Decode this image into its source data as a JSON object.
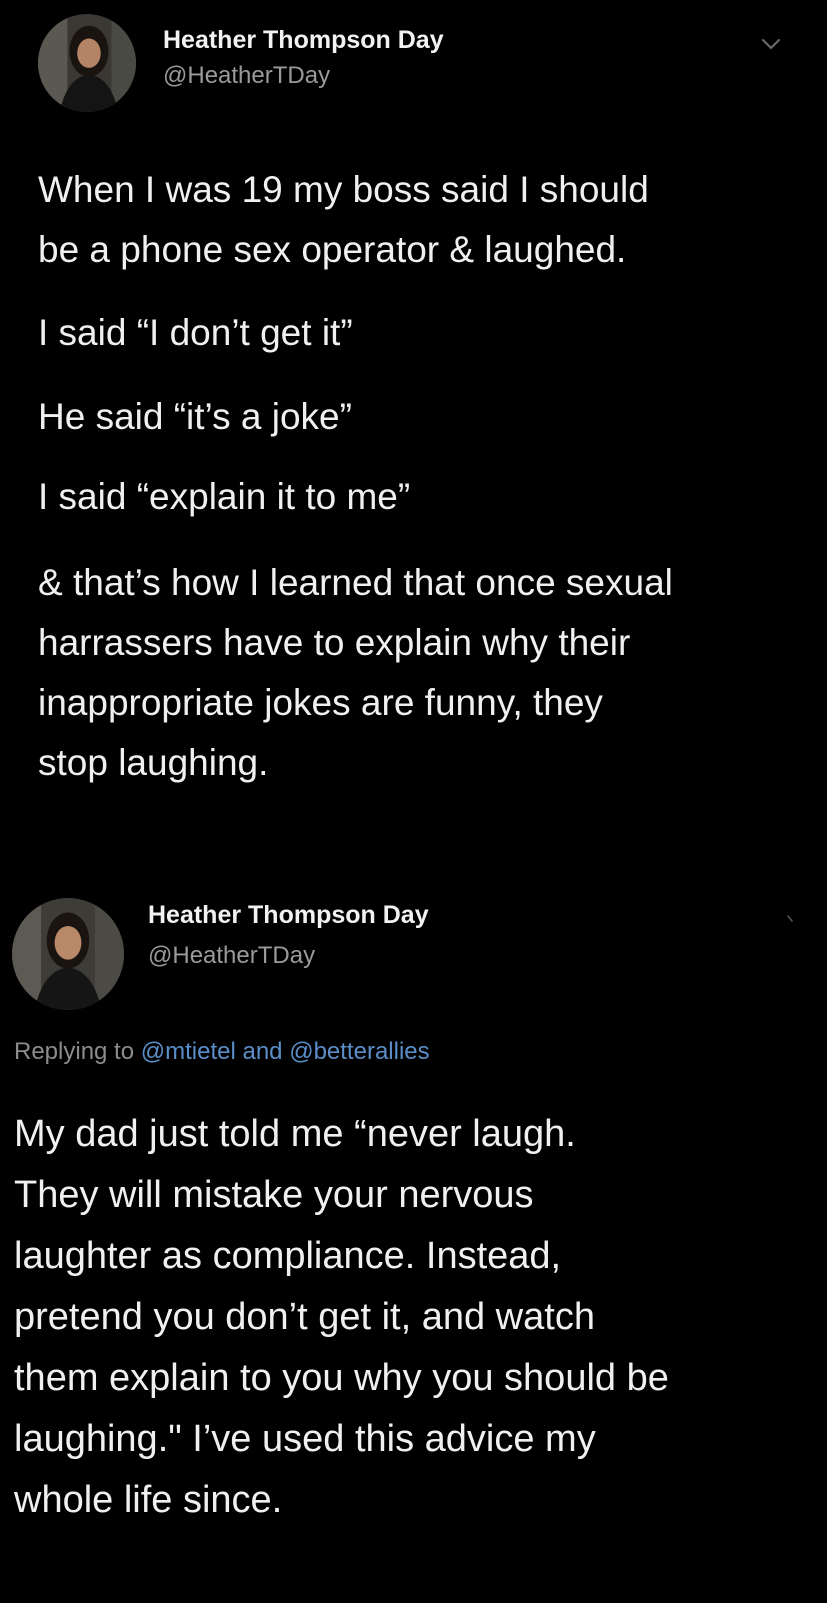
{
  "tweets": [
    {
      "author": {
        "name": "Heather Thompson Day",
        "handle": "@HeatherTDay",
        "avatar_icon": "profile-photo"
      },
      "menu_icon": "chevron-down-icon",
      "paragraphs": [
        "When I was 19 my boss said I should\nbe a phone sex operator & laughed.",
        "I said “I don’t get it”",
        "He said “it’s a joke”",
        "I said “explain it to me”",
        "& that’s how I learned that once sexual\nharrassers have to explain why their\ninappropriate jokes are funny, they\nstop laughing."
      ]
    },
    {
      "author": {
        "name": "Heather Thompson Day",
        "handle": "@HeatherTDay",
        "avatar_icon": "profile-photo"
      },
      "replying": {
        "prefix": "Replying to",
        "mention1": "@mtietel",
        "conj": "and",
        "mention2": "@betterallies"
      },
      "text": "My dad just told me “never laugh.\nThey will mistake your nervous\nlaughter as compliance. Instead,\npretend you don’t get it, and watch\nthem explain to you why you should be\nlaughing.\" I’ve used this advice my\nwhole life since."
    }
  ],
  "colors": {
    "background": "#000000",
    "text": "#f0f0f0",
    "secondary": "#9a9a9a",
    "mention": "#5b8ec8"
  }
}
